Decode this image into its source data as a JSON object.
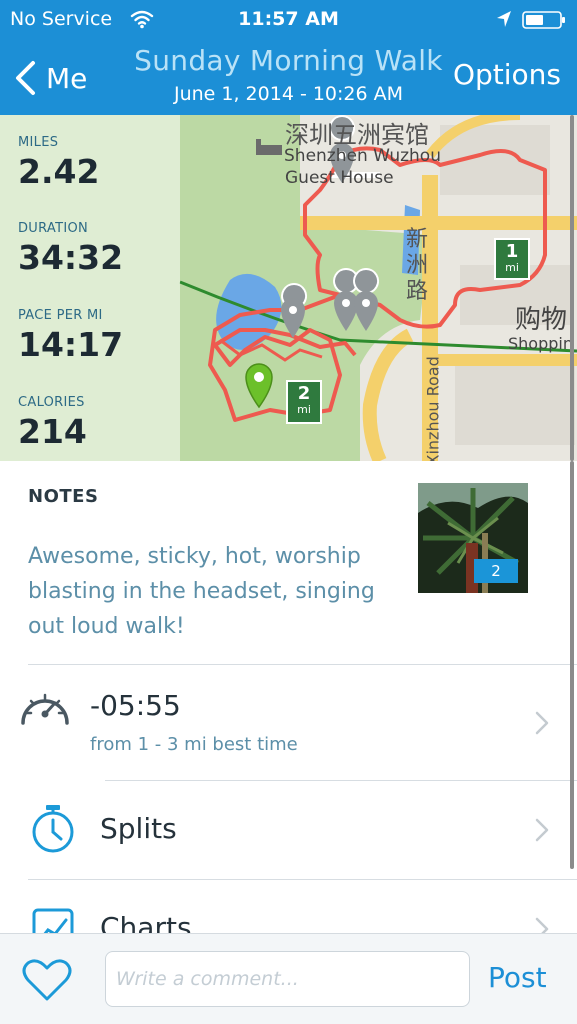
{
  "status_bar": {
    "carrier": "No Service",
    "time": "11:57 AM",
    "icons": [
      "wifi-icon",
      "location-arrow-icon",
      "battery-icon"
    ]
  },
  "nav": {
    "back_label": "Me",
    "title": "Sunday Morning Walk",
    "subtitle": "June 1, 2014 - 10:26 AM",
    "options_label": "Options"
  },
  "stats": [
    {
      "label": "MILES",
      "value": "2.42"
    },
    {
      "label": "DURATION",
      "value": "34:32"
    },
    {
      "label": "PACE PER MI",
      "value": "14:17"
    },
    {
      "label": "CALORIES",
      "value": "214"
    }
  ],
  "map": {
    "labels": {
      "hotel_cn": "深圳五洲宾馆",
      "hotel_en_1": "Shenzhen Wuzhou",
      "hotel_en_2": "Guest House",
      "road_cn": "新洲路",
      "road_en": "Xinzhou Road",
      "shop_cn": "购物",
      "shop_en": "Shoppin"
    },
    "markers": [
      {
        "number": "1",
        "unit": "mi"
      },
      {
        "number": "2",
        "unit": "mi"
      }
    ],
    "colors": {
      "route": "#ee5a4f",
      "marker": "#2f7a3e",
      "start_pin": "#6cc02a",
      "pin": "#8f9599"
    }
  },
  "notes": {
    "title": "NOTES",
    "lines": [
      "Awesome, sticky, hot, worship",
      "blasting in the headset, singing",
      "out loud walk!"
    ],
    "photo_count": "2"
  },
  "achievement": {
    "value": "-05:55",
    "subtitle": "from 1 - 3 mi best time",
    "icon": "speedometer-icon"
  },
  "rows": [
    {
      "label": "Splits",
      "icon": "stopwatch-icon"
    },
    {
      "label": "Charts",
      "icon": "chart-icon"
    }
  ],
  "bottom_bar": {
    "comment_placeholder": "Write a comment...",
    "post_label": "Post",
    "icon": "heart-icon"
  },
  "accent_color": "#1c8fd6"
}
